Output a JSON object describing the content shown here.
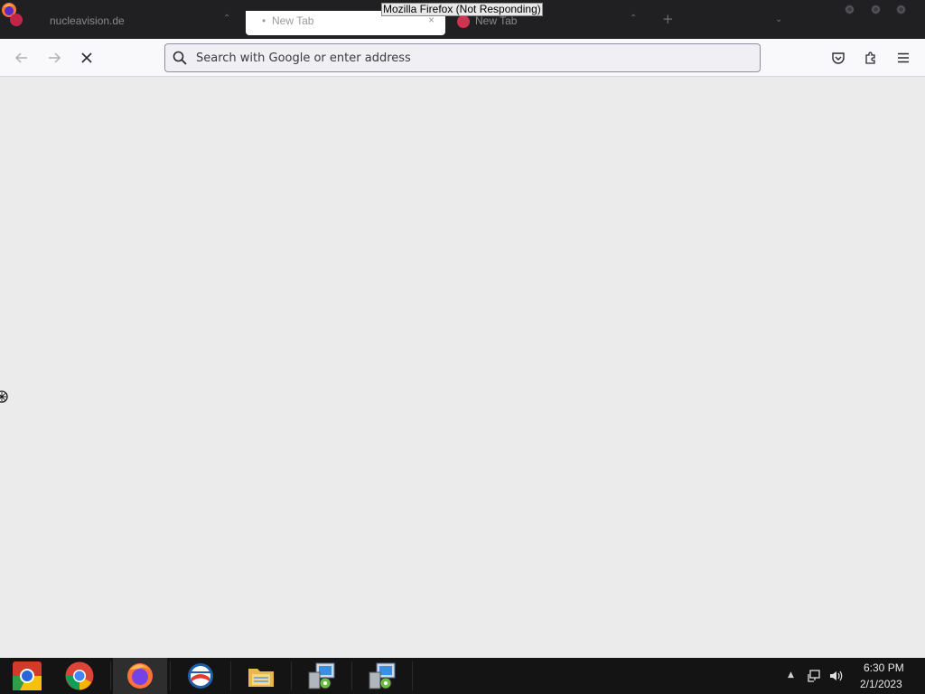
{
  "window": {
    "title": "Mozilla Firefox (Not Responding)"
  },
  "tabs": [
    {
      "label": "nucleavision.de",
      "active": false
    },
    {
      "label": "New Tab",
      "active": true,
      "close": "×"
    },
    {
      "label": "New Tab",
      "active": false
    }
  ],
  "new_tab_symbol": "+",
  "navbar": {
    "url_placeholder": "Search with Google or enter address"
  },
  "taskbar": {
    "apps": [
      {
        "name": "chromium",
        "icon": "chromium-icon"
      },
      {
        "name": "chrome",
        "icon": "chrome-icon"
      },
      {
        "name": "firefox",
        "icon": "firefox-icon",
        "active": true
      },
      {
        "name": "thunderbird-like",
        "icon": "mail-globe-icon"
      },
      {
        "name": "file-manager",
        "icon": "folder-icon"
      },
      {
        "name": "installer-1",
        "icon": "installer-icon"
      },
      {
        "name": "installer-2",
        "icon": "installer-icon"
      }
    ],
    "tray_up": "▲",
    "clock_time": "6:30 PM",
    "clock_date": "2/1/2023"
  },
  "colors": {
    "titlebar": "#202023",
    "toolbar": "#f9f9fb",
    "content": "#ebebeb",
    "taskbar": "#141414"
  }
}
